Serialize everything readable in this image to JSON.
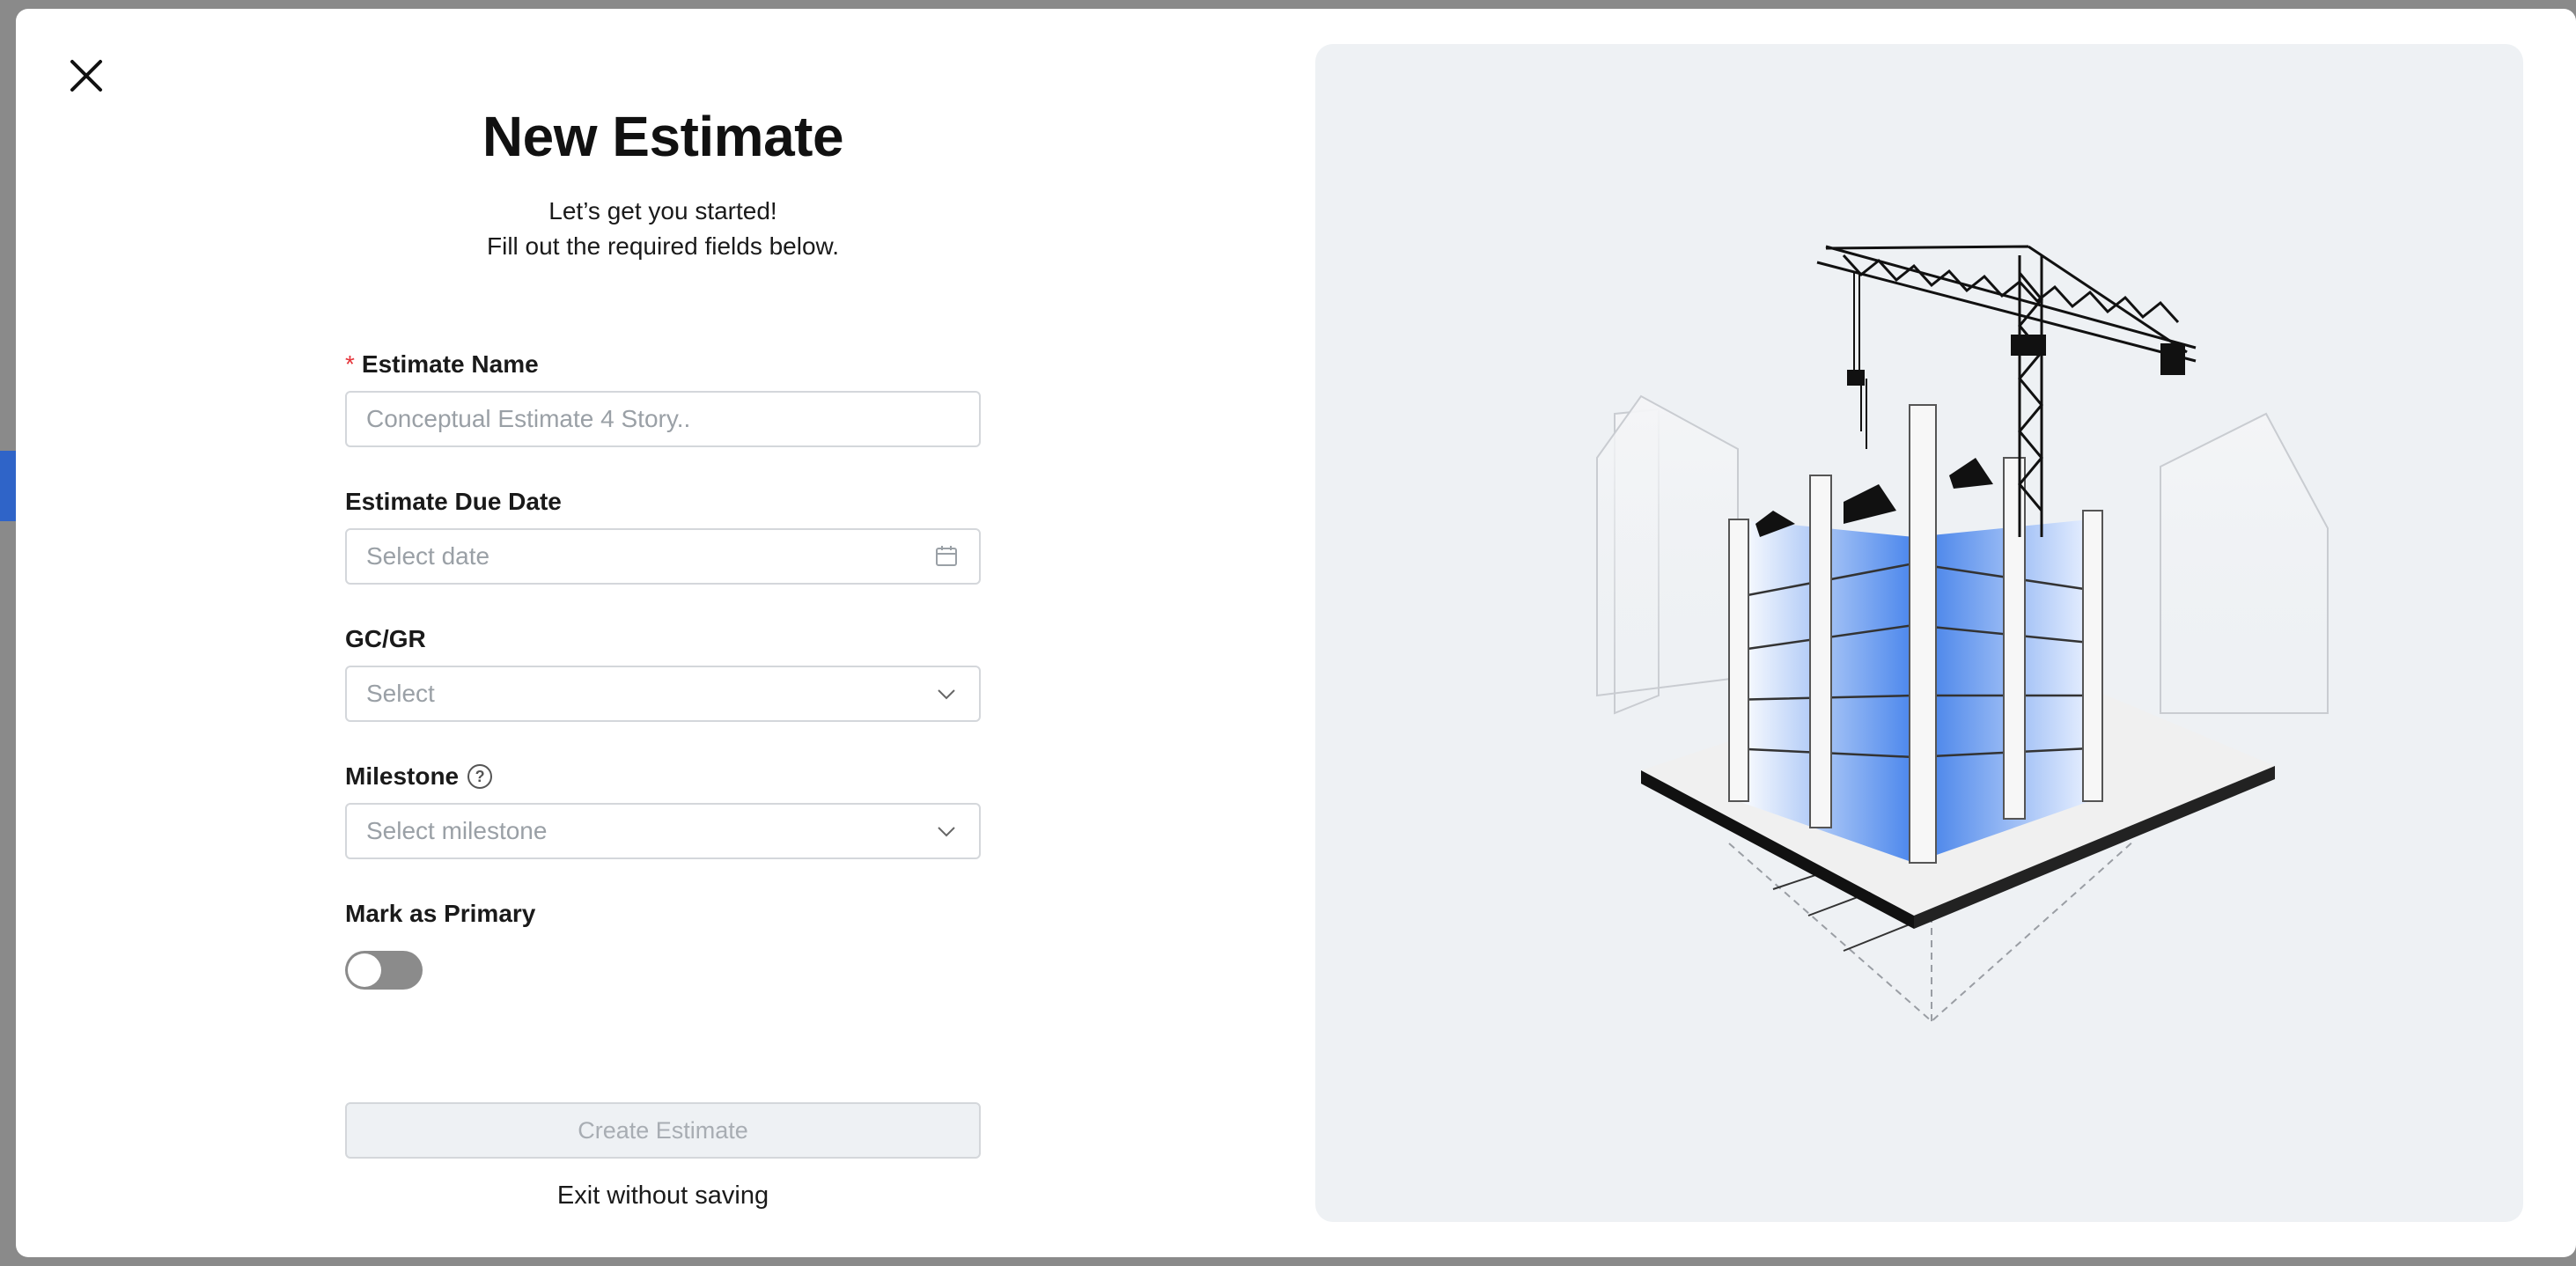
{
  "modal": {
    "title": "New Estimate",
    "subtitle_line1": "Let’s get you started!",
    "subtitle_line2": "Fill out the required fields below."
  },
  "fields": {
    "estimate_name": {
      "label": "Estimate Name",
      "required_mark": "*",
      "placeholder": "Conceptual Estimate 4 Story..",
      "value": ""
    },
    "due_date": {
      "label": "Estimate Due Date",
      "placeholder": "Select date"
    },
    "gc_gr": {
      "label": "GC/GR",
      "placeholder": "Select"
    },
    "milestone": {
      "label": "Milestone",
      "placeholder": "Select milestone",
      "help_glyph": "?"
    },
    "mark_primary": {
      "label": "Mark as Primary",
      "on": false
    }
  },
  "actions": {
    "create_label": "Create Estimate",
    "exit_label": "Exit without saving"
  },
  "icons": {
    "close": "close-icon",
    "calendar": "calendar-icon",
    "chevron": "chevron-down-icon",
    "help": "help-circle-icon"
  },
  "colors": {
    "required": "#e5343a",
    "panel_bg": "#eef1f4",
    "toggle_off": "#8b8b8b",
    "building_blue": "#3b7be8"
  }
}
